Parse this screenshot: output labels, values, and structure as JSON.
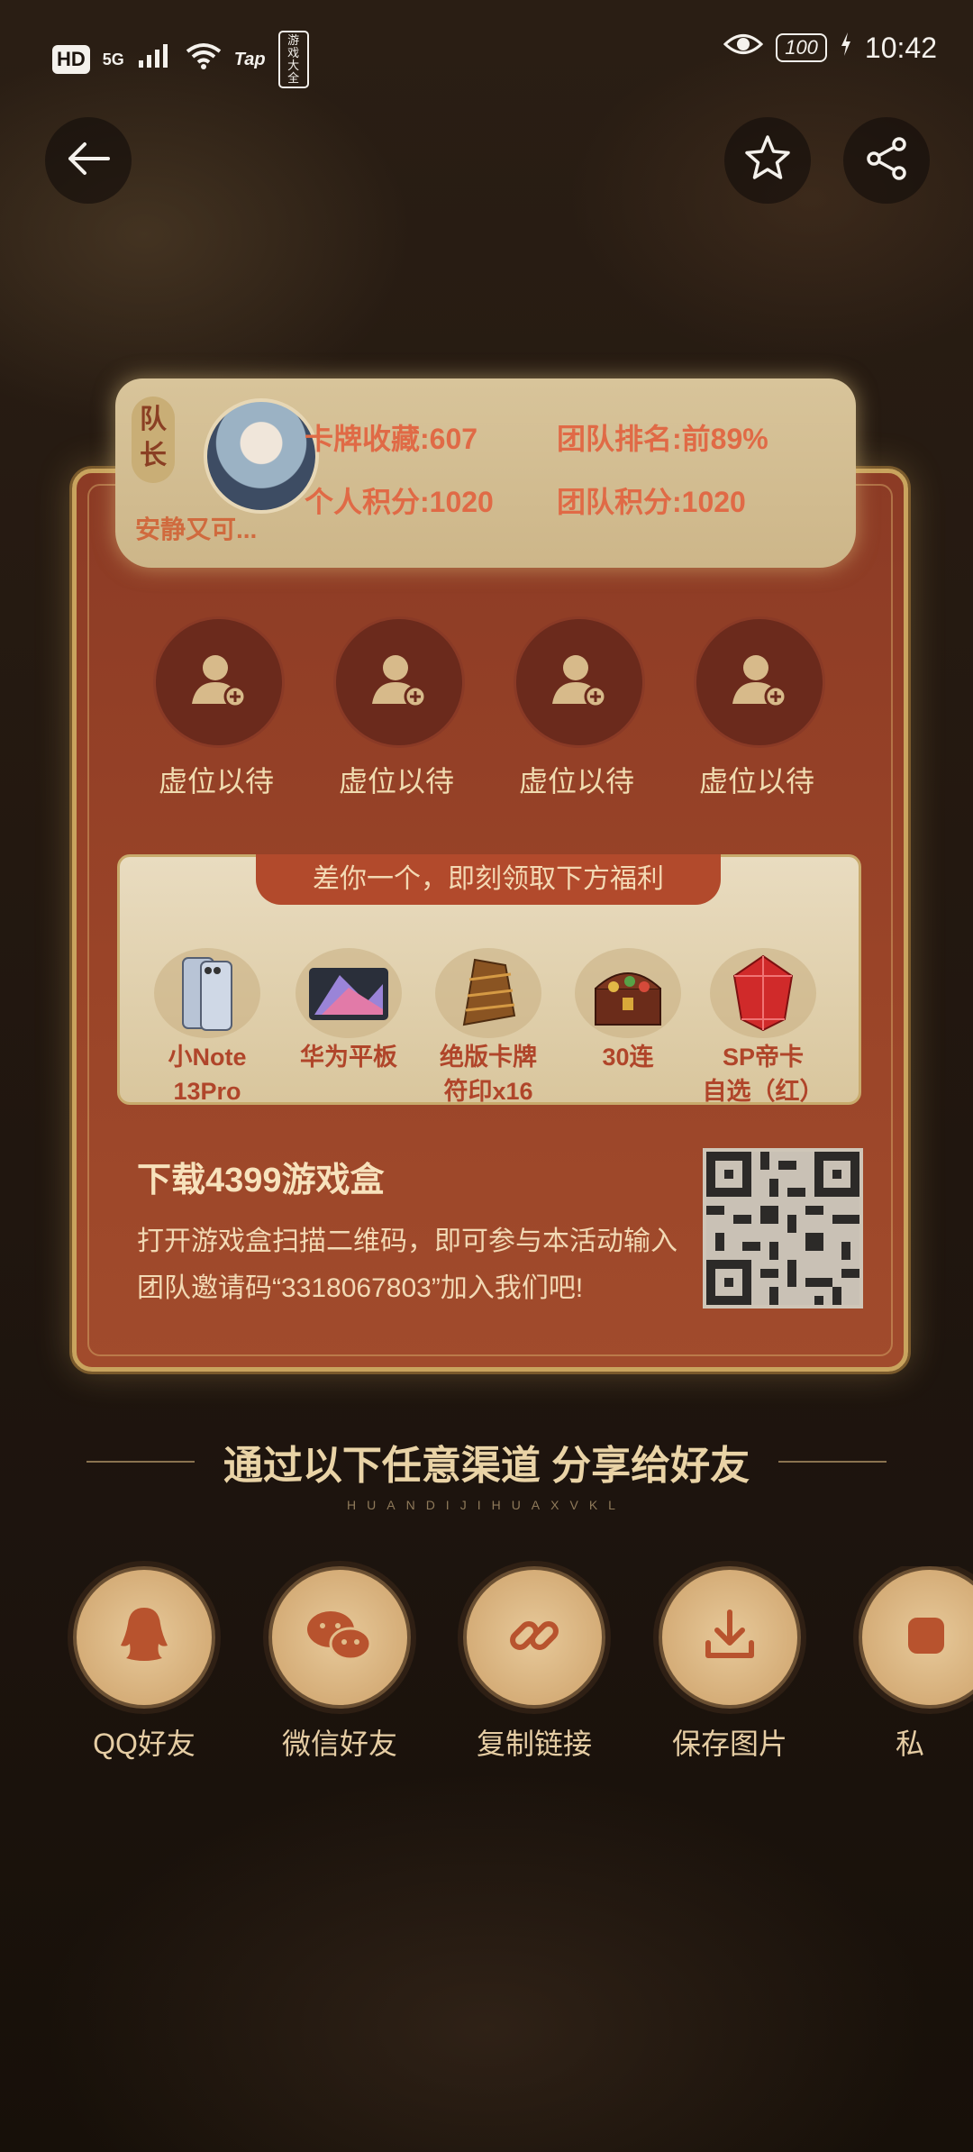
{
  "statusbar": {
    "hd": "HD",
    "network": "5G",
    "tap": "Tap",
    "game_box": "游戏大全",
    "battery": "100",
    "time": "10:42"
  },
  "nav": {
    "back_icon": "arrow-left-icon",
    "favorite_icon": "star-icon",
    "share_icon": "share-icon"
  },
  "captain": {
    "tag": "队长",
    "name": "安静又可...",
    "card_collection": "卡牌收藏:607",
    "team_rank": "团队排名:前89%",
    "personal_score": "个人积分:1020",
    "team_score": "团队积分:1020"
  },
  "slots": [
    {
      "label": "虚位以待"
    },
    {
      "label": "虚位以待"
    },
    {
      "label": "虚位以待"
    },
    {
      "label": "虚位以待"
    }
  ],
  "rewards": {
    "banner": "差你一个，即刻领取下方福利",
    "items": [
      {
        "line1": "小Note",
        "line2": "13Pro"
      },
      {
        "line1": "华为平板",
        "line2": ""
      },
      {
        "line1": "绝版卡牌",
        "line2": "符印x16"
      },
      {
        "line1": "30连",
        "line2": ""
      },
      {
        "line1": "SP帝卡",
        "line2": "自选（红）"
      }
    ]
  },
  "download": {
    "title": "下载4399游戏盒",
    "description": "打开游戏盒扫描二维码，即可参与本活动输入团队邀请码“3318067803”加入我们吧!"
  },
  "share": {
    "title": "通过以下任意渠道  分享给好友",
    "subtitle": "HUANDIJIHUAXVKL",
    "items": [
      {
        "label": "QQ好友",
        "icon": "qq-icon"
      },
      {
        "label": "微信好友",
        "icon": "wechat-icon"
      },
      {
        "label": "复制链接",
        "icon": "link-icon"
      },
      {
        "label": "保存图片",
        "icon": "download-icon"
      },
      {
        "label": "私",
        "icon": "app-icon"
      }
    ]
  },
  "colors": {
    "card": "#9a4428",
    "banner": "#d8c49a",
    "accent_text": "#e06a46"
  }
}
